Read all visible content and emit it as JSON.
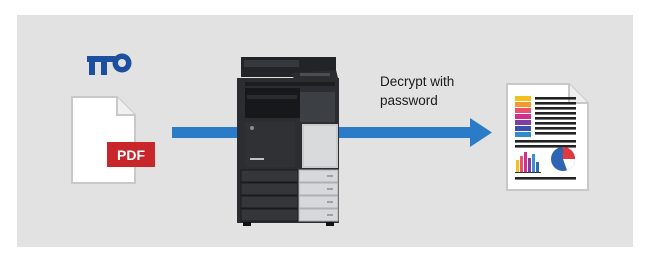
{
  "caption": {
    "line1": "Decrypt with",
    "line2": "password"
  },
  "source_file": {
    "badge_text": "PDF",
    "badge_color": "#c9262b",
    "icon": "document-icon"
  },
  "key": {
    "icon": "key-icon",
    "color": "#1d4fa0"
  },
  "device": {
    "icon": "mfp-printer-icon"
  },
  "output_file": {
    "icon": "decrypted-document-icon"
  },
  "arrow_color": "#2a7cc8",
  "panel_color": "#e2e2e2"
}
